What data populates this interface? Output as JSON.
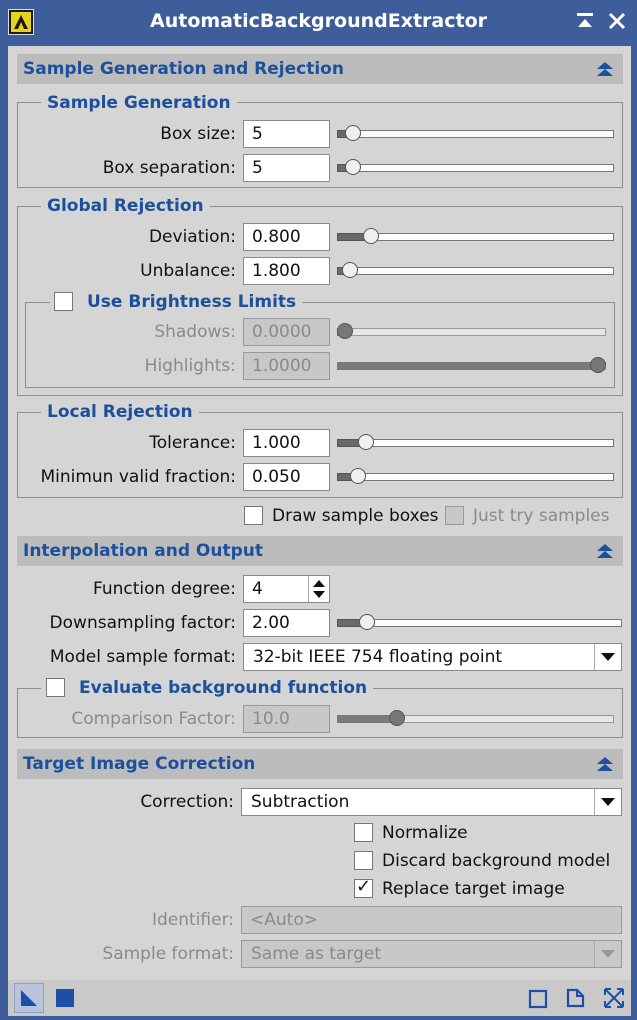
{
  "window": {
    "title": "AutomaticBackgroundExtractor"
  },
  "icons": {
    "app": "app-icon",
    "shade": "shade-window-icon",
    "close": "close-icon",
    "collapse": "collapse-up-icon",
    "new_instance": "new-instance-triangle-icon",
    "apply_global": "apply-global-square-icon",
    "preview": "preview-icon",
    "document": "document-icon",
    "reset": "reset-icon"
  },
  "colors": {
    "titlebar": "#3e5d9b",
    "section_title": "#1c4f9c",
    "panel": "#d5d5d5"
  },
  "sample_section": {
    "title": "Sample Generation and Rejection",
    "sample_generation": {
      "title": "Sample Generation",
      "box_size_label": "Box size:",
      "box_size_value": "5",
      "box_size_slider": 0.03,
      "box_separation_label": "Box separation:",
      "box_separation_value": "5",
      "box_separation_slider": 0.03
    },
    "global_rejection": {
      "title": "Global Rejection",
      "deviation_label": "Deviation:",
      "deviation_value": "0.800",
      "deviation_slider": 0.1,
      "unbalance_label": "Unbalance:",
      "unbalance_value": "1.800",
      "unbalance_slider": 0.02,
      "brightness_limits": {
        "title": "Use Brightness Limits",
        "checked": false,
        "shadows_label": "Shadows:",
        "shadows_value": "0.0000",
        "shadows_slider": 0.0,
        "highlights_label": "Highlights:",
        "highlights_value": "1.0000",
        "highlights_slider": 1.0
      }
    },
    "local_rejection": {
      "title": "Local Rejection",
      "tolerance_label": "Tolerance:",
      "tolerance_value": "1.000",
      "tolerance_slider": 0.08,
      "min_valid_label": "Minimun valid fraction:",
      "min_valid_value": "0.050",
      "min_valid_slider": 0.05
    },
    "draw_sample_boxes_label": "Draw sample boxes",
    "draw_sample_boxes_checked": false,
    "just_try_samples_label": "Just try samples",
    "just_try_samples_checked": false
  },
  "interpolation_section": {
    "title": "Interpolation and Output",
    "function_degree_label": "Function degree:",
    "function_degree_value": "4",
    "downsampling_label": "Downsampling factor:",
    "downsampling_value": "2.00",
    "downsampling_slider": 0.08,
    "model_format_label": "Model sample format:",
    "model_format_value": "32-bit IEEE 754 floating point",
    "evaluate": {
      "title": "Evaluate background function",
      "checked": false,
      "comparison_label": "Comparison Factor:",
      "comparison_value": "10.0",
      "comparison_slider": 0.2
    }
  },
  "target_section": {
    "title": "Target Image Correction",
    "correction_label": "Correction:",
    "correction_value": "Subtraction",
    "normalize_label": "Normalize",
    "normalize_checked": false,
    "discard_label": "Discard background model",
    "discard_checked": false,
    "replace_label": "Replace target image",
    "replace_checked": true,
    "check_glyph": "✓",
    "identifier_label": "Identifier:",
    "identifier_placeholder": "<Auto>",
    "sample_format_label": "Sample format:",
    "sample_format_value": "Same as target"
  }
}
